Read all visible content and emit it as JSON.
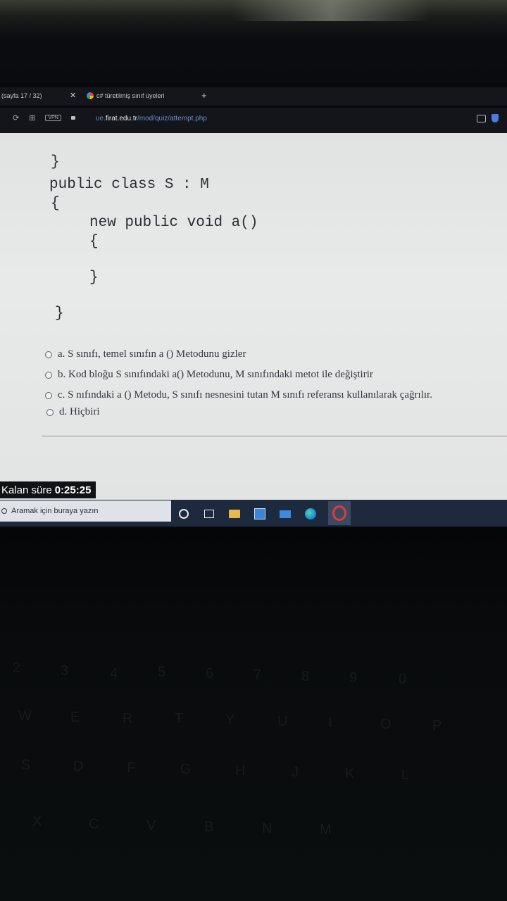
{
  "browser": {
    "tab1_label": "(sayfa 17 / 32)",
    "tab2_label": "c# türetilmiş sınıf üyeleri",
    "url_prefix": "ue.",
    "url_host": "firat.edu.tr",
    "url_path": "/mod/quiz/attempt.php",
    "vpn_label": "VPN"
  },
  "code": {
    "lines": [
      "}",
      "public class S : M",
      "{",
      "     new public void a()",
      "     {",
      "",
      "     }",
      "",
      "}"
    ]
  },
  "options": [
    {
      "label": "a. S sınıfı, temel sınıfın a () Metodunu gizler"
    },
    {
      "label": "b. Kod bloğu S sınıfındaki a() Metodunu, M sınıfındaki metot ile değiştirir"
    },
    {
      "label": "c. S nıfındaki a () Metodu, S sınıfı nesnesini tutan M sınıfı referansı kullanılarak çağrılır."
    },
    {
      "label": "d. Hiçbiri"
    }
  ],
  "timer": {
    "label": "Kalan süre",
    "value": "0:25:25"
  },
  "taskbar": {
    "search_placeholder": "Aramak için buraya yazın"
  },
  "keyboard": {
    "keys": [
      "2",
      "3",
      "4",
      "5",
      "6",
      "7",
      "8",
      "9",
      "0",
      "W",
      "E",
      "R",
      "T",
      "Y",
      "U",
      "I",
      "O",
      "P",
      "S",
      "D",
      "F",
      "G",
      "H",
      "J",
      "K",
      "L",
      "X",
      "C",
      "V",
      "B",
      "N",
      "M"
    ]
  }
}
